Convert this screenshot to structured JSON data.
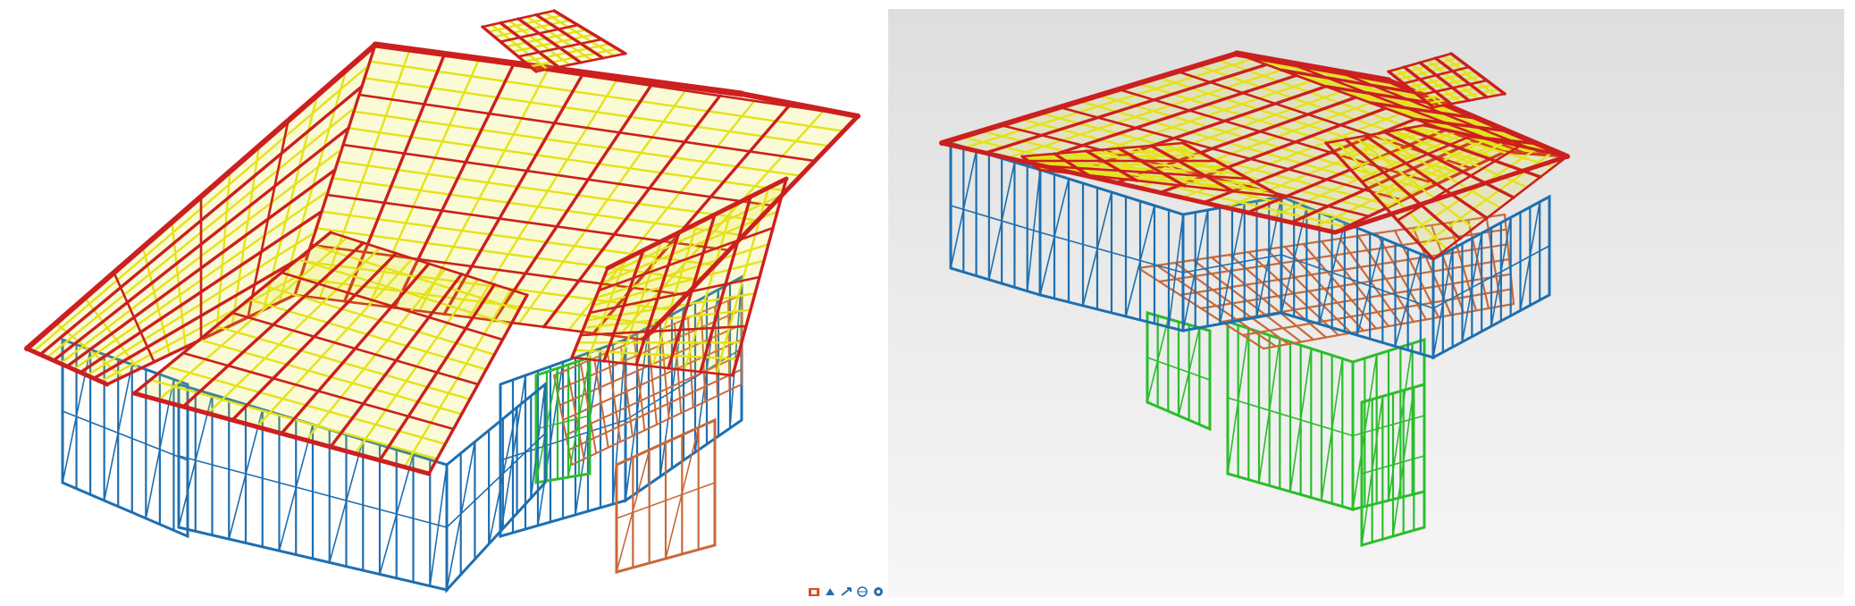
{
  "scenes": [
    {
      "name": "left-render",
      "colors": {
        "rafters": "#cc1f1f",
        "battens": "#e4e21a",
        "walls": "#1e6fb0",
        "lower_walls": "#2bbd2b",
        "floor": "#c8693a",
        "background": "#ffffff"
      }
    },
    {
      "name": "right-render",
      "colors": {
        "rafters": "#cc1f1f",
        "battens": "#e4e21a",
        "walls": "#1e6fb0",
        "lower_walls": "#2bbd2b",
        "floor": "#c8693a",
        "background": "#e4e5e4"
      }
    }
  ],
  "toolbar": {
    "icons": [
      "app-logo-icon",
      "paint-icon",
      "arrow-icon",
      "globe-icon",
      "help-icon"
    ],
    "colors": [
      "#e04a1c",
      "#2a6ab3",
      "#2a6ab3",
      "#2a6ab3",
      "#2a6ab3"
    ]
  }
}
